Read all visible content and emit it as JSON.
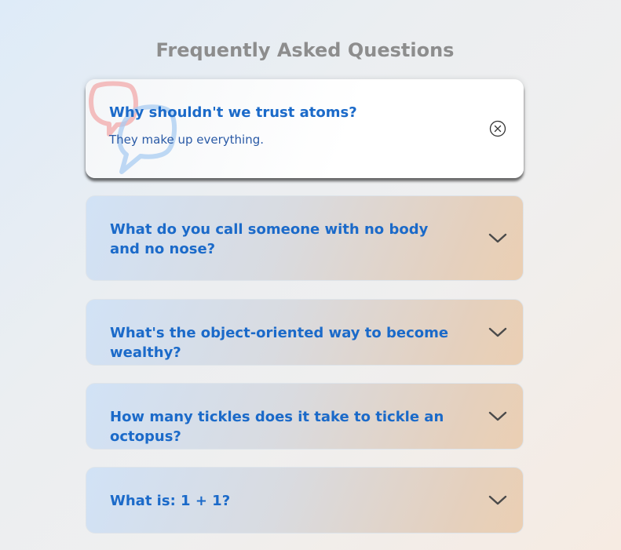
{
  "page": {
    "title": "Frequently Asked Questions"
  },
  "faqs": [
    {
      "question": "Why shouldn't we trust atoms?",
      "answer": "They make up everything.",
      "state": "open",
      "toggle_icon": "close-circle-icon"
    },
    {
      "question": "What do you call someone with no body and no nose?",
      "state": "collapsed",
      "toggle_icon": "chevron-down-icon"
    },
    {
      "question": "What's the object-oriented way to become wealthy?",
      "state": "collapsed",
      "toggle_icon": "chevron-down-icon"
    },
    {
      "question": "How many tickles does it take to tickle an octopus?",
      "state": "collapsed",
      "toggle_icon": "chevron-down-icon"
    },
    {
      "question": "What is: 1 + 1?",
      "state": "collapsed",
      "toggle_icon": "chevron-down-icon"
    }
  ],
  "colors": {
    "title": "#8d8d8d",
    "question": "#1b6ac9",
    "answer": "#2a5aa6",
    "chat_icon_red": "#f1a9a9",
    "chat_icon_blue": "#a9ccf1"
  },
  "decorations": {
    "open_item_icon": "chat-bubbles-icon"
  }
}
